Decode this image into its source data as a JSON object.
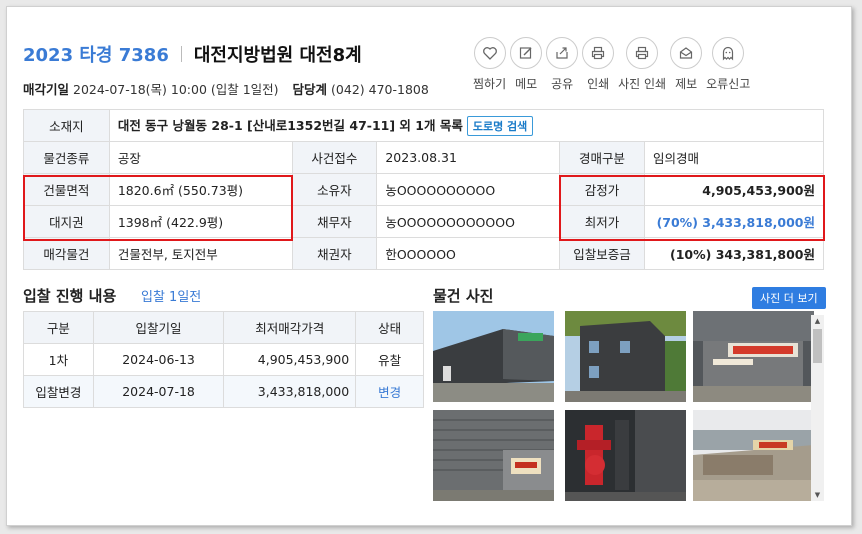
{
  "header": {
    "case_no": "2023 타경 7386",
    "court": "대전지방법원 대전8계",
    "sale_date_label": "매각기일",
    "sale_date": "2024-07-18(목) 10:00 (입찰 1일전)",
    "dept_label": "담당계",
    "dept_phone": "(042) 470-1808"
  },
  "actions": [
    {
      "label": "찜하기",
      "icon": "heart-icon"
    },
    {
      "label": "메모",
      "icon": "pencil-icon"
    },
    {
      "label": "공유",
      "icon": "share-icon"
    },
    {
      "label": "인쇄",
      "icon": "printer-icon"
    },
    {
      "label": "사진 인쇄",
      "icon": "photo-print-icon"
    },
    {
      "label": "제보",
      "icon": "envelope-icon"
    },
    {
      "label": "오류신고",
      "icon": "ghost-icon"
    }
  ],
  "info": {
    "location_label": "소재지",
    "location_value": "대전 동구 낭월동 28-1 [산내로1352번길 47-11] 외 1개 목록",
    "road_search": "도로명 검색",
    "type_label": "물건종류",
    "type_value": "공장",
    "received_label": "사건접수",
    "received_value": "2023.08.31",
    "auction_type_label": "경매구분",
    "auction_type_value": "임의경매",
    "bldg_area_label": "건물면적",
    "bldg_area_value": "1820.6㎡ (550.73평)",
    "owner_label": "소유자",
    "owner_value": "농OOOOOOOOOO",
    "appraisal_label": "감정가",
    "appraisal_value": "4,905,453,900원",
    "land_label": "대지권",
    "land_value": "1398㎡ (422.9평)",
    "debtor_label": "채무자",
    "debtor_value": "농OOOOOOOOOOOO",
    "min_price_label": "최저가",
    "min_price_value": "(70%) 3,433,818,000원",
    "sale_items_label": "매각물건",
    "sale_items_value": "건물전부, 토지전부",
    "creditor_label": "채권자",
    "creditor_value": "한OOOOOO",
    "deposit_label": "입찰보증금",
    "deposit_value": "(10%) 343,381,800원"
  },
  "bid_section": {
    "title": "입찰 진행 내용",
    "link": "입찰 1일전",
    "headers": [
      "구분",
      "입찰기일",
      "최저매각가격",
      "상태"
    ],
    "rows": [
      {
        "round": "1차",
        "date": "2024-06-13",
        "price": "4,905,453,900",
        "status": "유찰"
      },
      {
        "round": "입찰변경",
        "date": "2024-07-18",
        "price": "3,433,818,000",
        "status": "변경"
      }
    ]
  },
  "photo_section": {
    "title": "물건 사진",
    "more_button": "사진 더 보기"
  },
  "colors": {
    "accent": "#3a7bd5",
    "highlight_box": "#e0181b",
    "header_cell": "#f1f4f8"
  }
}
